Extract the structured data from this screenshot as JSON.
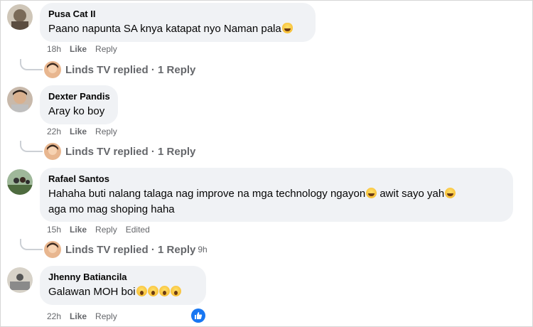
{
  "comments": [
    {
      "author": "Pusa Cat II",
      "text": "Paano napunta SA knya katapat nyo Naman pala",
      "time": "18h",
      "like": "Like",
      "reply": "Reply",
      "reply_thread": {
        "label": "Linds TV replied · 1 Reply"
      }
    },
    {
      "author": "Dexter Pandis",
      "text": "Aray ko boy",
      "time": "22h",
      "like": "Like",
      "reply": "Reply",
      "reply_thread": {
        "label": "Linds TV replied · 1 Reply"
      }
    },
    {
      "author": "Rafael Santos",
      "text_line1": "Hahaha buti nalang talaga nag improve na mga technology ngayon",
      "text_line1b": " awit sayo yah",
      "text_line2": "aga mo mag shoping haha",
      "time": "15h",
      "like": "Like",
      "reply": "Reply",
      "edited": "Edited",
      "reply_thread": {
        "label": "Linds TV replied · 1 Reply",
        "time": "9h"
      }
    },
    {
      "author": "Jhenny Batiancila",
      "text": "Galawan MOH boi",
      "time": "22h",
      "like": "Like",
      "reply": "Reply"
    }
  ],
  "colors": {
    "bubble": "#f0f2f5",
    "muted": "#65676b",
    "like_badge": "#1877f2"
  },
  "icons": {
    "emoji_cat": "crying-laughing-cat",
    "emoji_laugh": "tears-of-joy",
    "emoji_surprise": "surprised-face",
    "reaction": "thumbs-up"
  }
}
